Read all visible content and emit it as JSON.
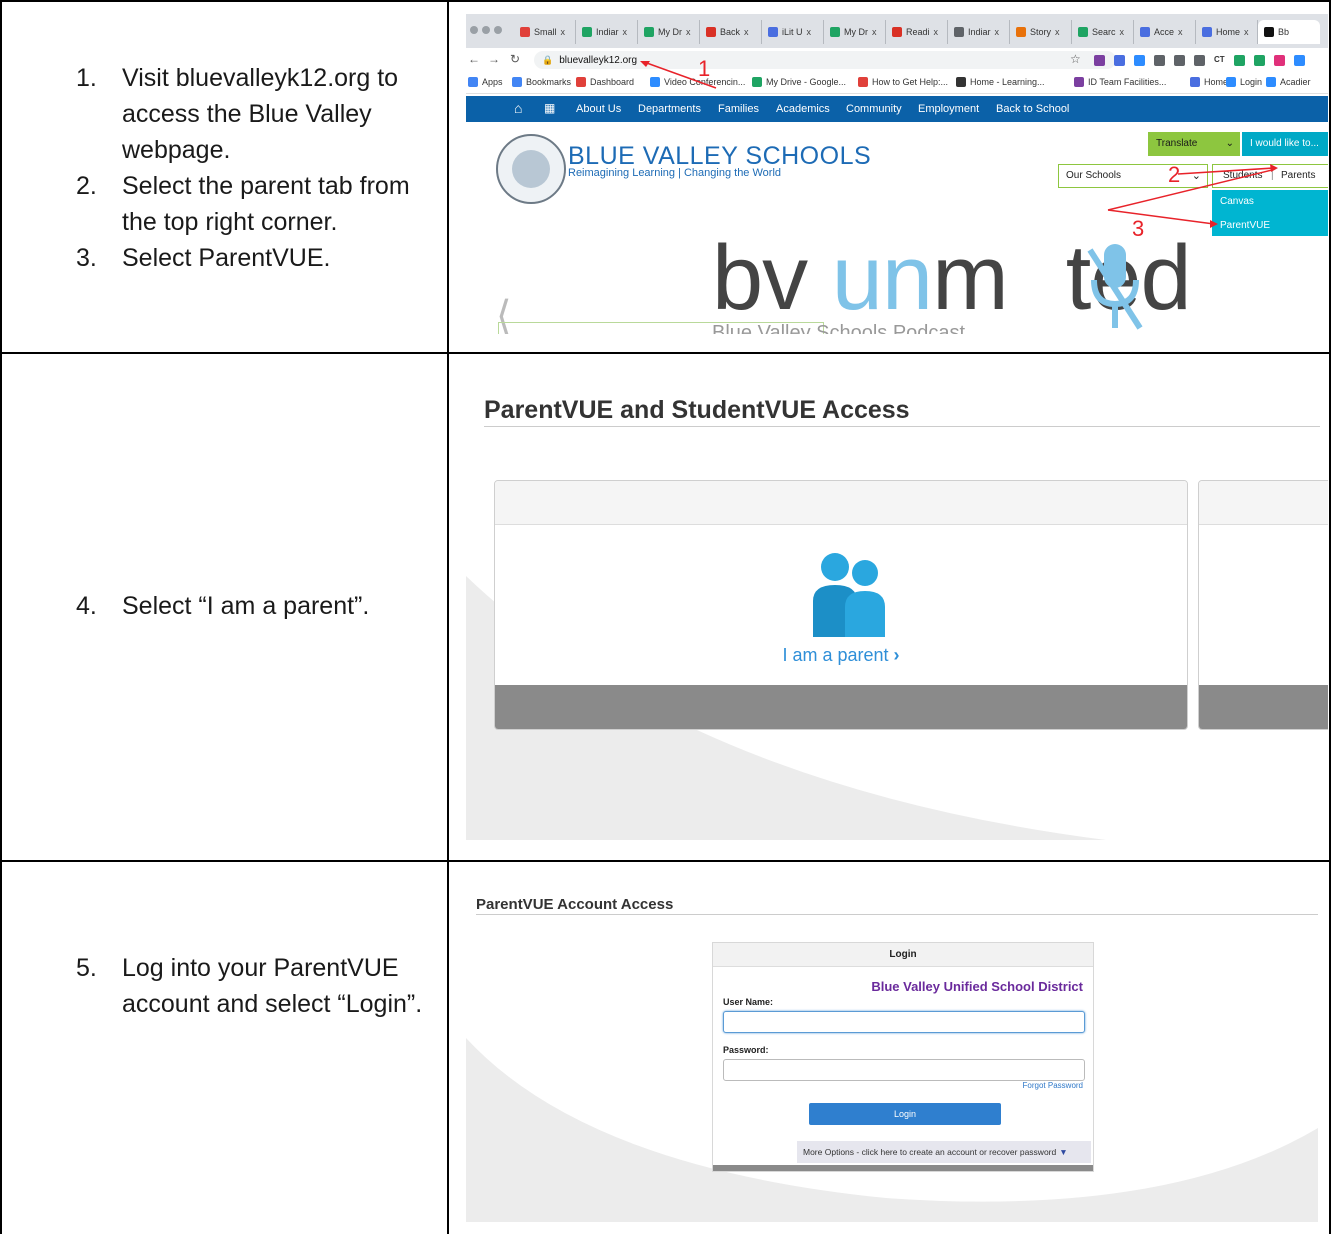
{
  "rows": [
    {
      "steps": [
        {
          "num": "1.",
          "text": "Visit bluevalleyk12.org to access the Blue Valley webpage."
        },
        {
          "num": "2.",
          "text": "Select the parent tab from the top right corner."
        },
        {
          "num": "3.",
          "text": "Select ParentVUE."
        }
      ]
    },
    {
      "steps": [
        {
          "num": "4.",
          "text": "Select “I am a parent”."
        }
      ]
    },
    {
      "steps": [
        {
          "num": "5.",
          "text": "Log into your ParentVUE account and select “Login”."
        }
      ]
    }
  ],
  "browser": {
    "tabs": [
      {
        "label": "Small",
        "color": "#e0403a"
      },
      {
        "label": "Indiar",
        "color": "#1fa463"
      },
      {
        "label": "My Dr",
        "color": "#1fa463"
      },
      {
        "label": "Back",
        "color": "#d93025"
      },
      {
        "label": "iLit U",
        "color": "#4a6ee0"
      },
      {
        "label": "My Dr",
        "color": "#1fa463"
      },
      {
        "label": "Readi",
        "color": "#d93025"
      },
      {
        "label": "Indiar",
        "color": "#5f6368"
      },
      {
        "label": "Story",
        "color": "#e8710a"
      },
      {
        "label": "Searc",
        "color": "#1fa463"
      },
      {
        "label": "Acce",
        "color": "#4a6ee0"
      },
      {
        "label": "Home",
        "color": "#4a6ee0"
      },
      {
        "label": "Bb",
        "color": "#111111"
      }
    ],
    "tab_close": "x",
    "url": "bluevalleyk12.org",
    "bookmarks": [
      {
        "label": "Apps",
        "color": "#4285f4"
      },
      {
        "label": "Bookmarks",
        "color": "#4285f4"
      },
      {
        "label": "Dashboard",
        "color": "#e0403a"
      },
      {
        "label": "Video Conferencin...",
        "color": "#2d8cff"
      },
      {
        "label": "My Drive - Google...",
        "color": "#1fa463"
      },
      {
        "label": "How to Get Help:...",
        "color": "#e0403a"
      },
      {
        "label": "Home - Learning...",
        "color": "#333333"
      },
      {
        "label": "ID Team Facilities...",
        "color": "#7b3fa0"
      },
      {
        "label": "Home",
        "color": "#4a6ee0"
      },
      {
        "label": "Login",
        "color": "#2d8cff"
      },
      {
        "label": "Acadier",
        "color": "#2d8cff"
      }
    ],
    "extension_colors": [
      "#7b3fa0",
      "#4a6ee0",
      "#2d8cff",
      "#5f6368",
      "#5f6368",
      "#5f6368",
      "#9aa0a6",
      "#1fa463",
      "#1fa463",
      "#e0307a",
      "#2d8cff"
    ],
    "ext_text": "CT"
  },
  "site": {
    "nav": [
      "About Us",
      "Departments",
      "Families",
      "Academics",
      "Community",
      "Employment",
      "Back to School"
    ],
    "school_name": "BLUE VALLEY SCHOOLS",
    "tagline": "Reimagining Learning | Changing the World",
    "translate": "Translate",
    "would_like": "I would like to...",
    "our_schools": "Our Schools",
    "students": "Students",
    "parents": "Parents",
    "dropdown": [
      "Canvas",
      "ParentVUE"
    ],
    "podcast_a": "bv ",
    "podcast_b": "un",
    "podcast_c": "m",
    "podcast_d": "ted",
    "podcast_sub": "Blue Valley Schools Podcast",
    "colors": {
      "brand": "#0b61a8",
      "translate": "#8dc63f",
      "cyan": "#00a9c6"
    }
  },
  "annotations": [
    "1",
    "2",
    "3"
  ],
  "access": {
    "title": "ParentVUE and StudentVUE Access",
    "parent_link": "I am a parent"
  },
  "login": {
    "title": "ParentVUE Account Access",
    "panel_title": "Login",
    "district": "Blue Valley Unified School District",
    "username_label": "User Name:",
    "password_label": "Password:",
    "forgot": "Forgot Password",
    "login_button": "Login",
    "more_options": "More Options - click here to create an account or recover password"
  }
}
